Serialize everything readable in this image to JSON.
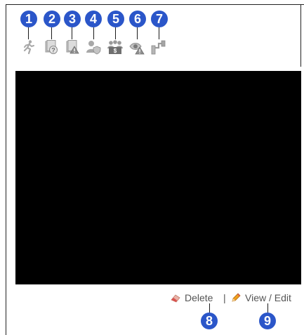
{
  "callouts": [
    "1",
    "2",
    "3",
    "4",
    "5",
    "6",
    "7",
    "8",
    "9"
  ],
  "toolbar": {
    "icons": [
      "running-person-icon",
      "document-question-icon",
      "document-warning-icon",
      "user-shield-icon",
      "group-badge-icon",
      "eye-warning-icon",
      "connector-plug-icon"
    ]
  },
  "actions": {
    "delete_label": "Delete",
    "separator": "|",
    "view_edit_label": "View / Edit",
    "delete_icon": "eraser-icon",
    "view_edit_icon": "pencil-icon"
  },
  "colors": {
    "badge": "#2b56c9",
    "preview": "#000000",
    "link_text": "#555555",
    "icon_gray": "#9a9a9a"
  }
}
